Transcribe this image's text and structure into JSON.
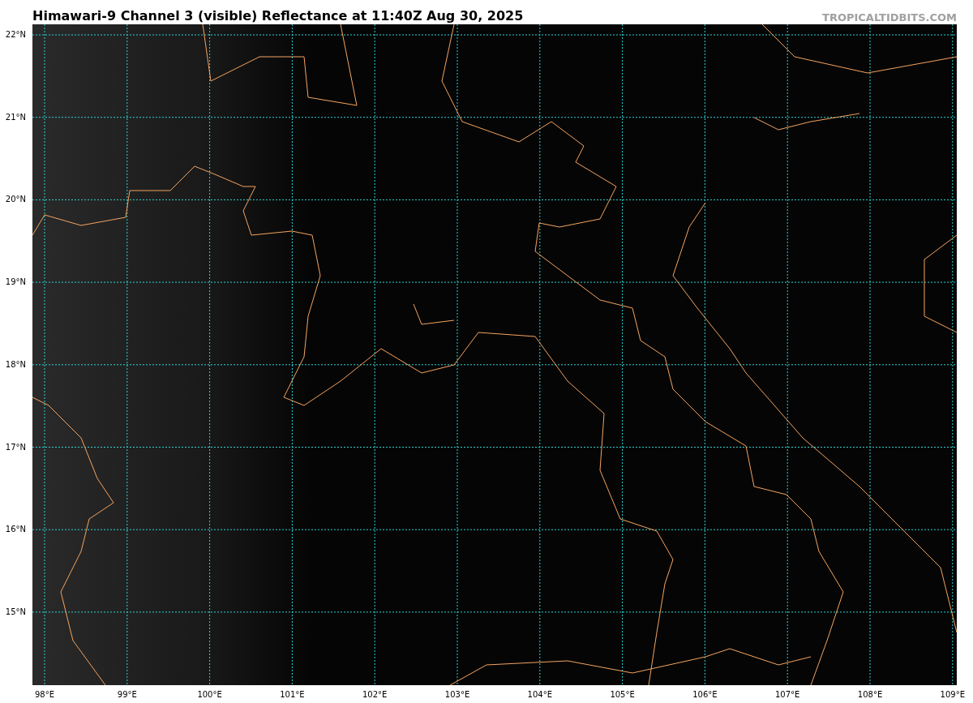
{
  "title": "Himawari-9 Channel 3 (visible) Reflectance at 11:40Z Aug 30, 2025",
  "credit": "TROPICALTIDBITS.COM",
  "map": {
    "x_ticks": [
      "98°E",
      "99°E",
      "100°E",
      "101°E",
      "102°E",
      "103°E",
      "104°E",
      "105°E",
      "106°E",
      "107°E",
      "108°E",
      "109°E"
    ],
    "y_ticks": [
      "22°N",
      "21°N",
      "20°N",
      "19°N",
      "18°N",
      "17°N",
      "16°N",
      "15°N"
    ]
  }
}
